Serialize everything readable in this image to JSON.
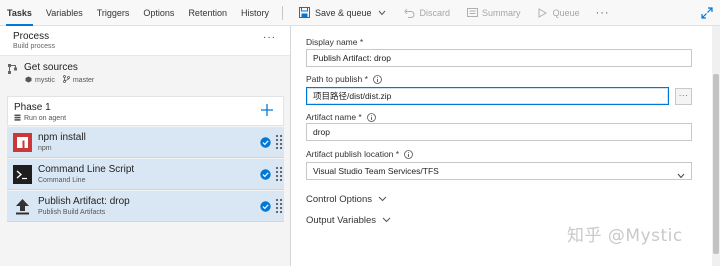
{
  "tabs": [
    {
      "label": "Tasks",
      "active": true
    },
    {
      "label": "Variables"
    },
    {
      "label": "Triggers"
    },
    {
      "label": "Options"
    },
    {
      "label": "Retention"
    },
    {
      "label": "History"
    }
  ],
  "toolbar": {
    "save_queue": "Save & queue",
    "discard": "Discard",
    "summary": "Summary",
    "queue": "Queue",
    "more": "···"
  },
  "process": {
    "title": "Process",
    "subtitle": "Build process",
    "more": "···"
  },
  "get_sources": {
    "title": "Get sources",
    "repo": "mystic",
    "branch": "master"
  },
  "phase": {
    "title": "Phase 1",
    "subtitle": "Run on agent"
  },
  "tasks": [
    {
      "title": "npm install",
      "subtitle": "npm",
      "icon": "npm-icon"
    },
    {
      "title": "Command Line Script",
      "subtitle": "Command Line",
      "icon": "terminal-icon"
    },
    {
      "title": "Publish Artifact: drop",
      "subtitle": "Publish Build Artifacts",
      "icon": "upload-icon"
    }
  ],
  "form": {
    "display_name_label": "Display name *",
    "display_name_value": "Publish Artifact: drop",
    "path_label": "Path to publish *",
    "path_value": "项目路径/dist/dist.zip",
    "browse": "···",
    "artifact_name_label": "Artifact name *",
    "artifact_name_value": "drop",
    "location_label": "Artifact publish location *",
    "location_value": "Visual Studio Team Services/TFS",
    "control_options": "Control Options",
    "output_variables": "Output Variables"
  },
  "watermark": "知乎 @Mystic",
  "colors": {
    "accent": "#0078d7",
    "selected_row": "#d9e7f5",
    "npm_red": "#cb3837"
  }
}
